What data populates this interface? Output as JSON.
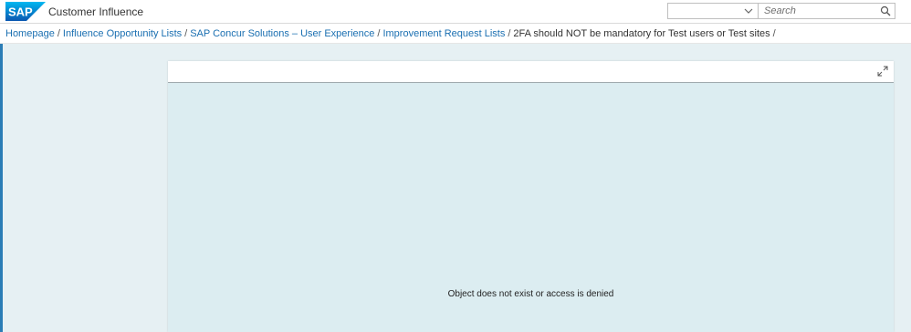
{
  "header": {
    "logo_text": "SAP",
    "brand_color": "#0a6ed1",
    "title": "Customer Influence",
    "select": {
      "value": ""
    },
    "search": {
      "placeholder": "Search",
      "icon": "search-icon"
    }
  },
  "breadcrumb": {
    "items": [
      "Homepage",
      "Influence Opportunity Lists",
      "SAP Concur Solutions – User Experience",
      "Improvement Request Lists"
    ],
    "current": "2FA should NOT be mandatory for Test users or Test sites",
    "separator": "/"
  },
  "panel": {
    "expand_icon": "expand-icon",
    "message": "Object does not exist or access is denied"
  }
}
